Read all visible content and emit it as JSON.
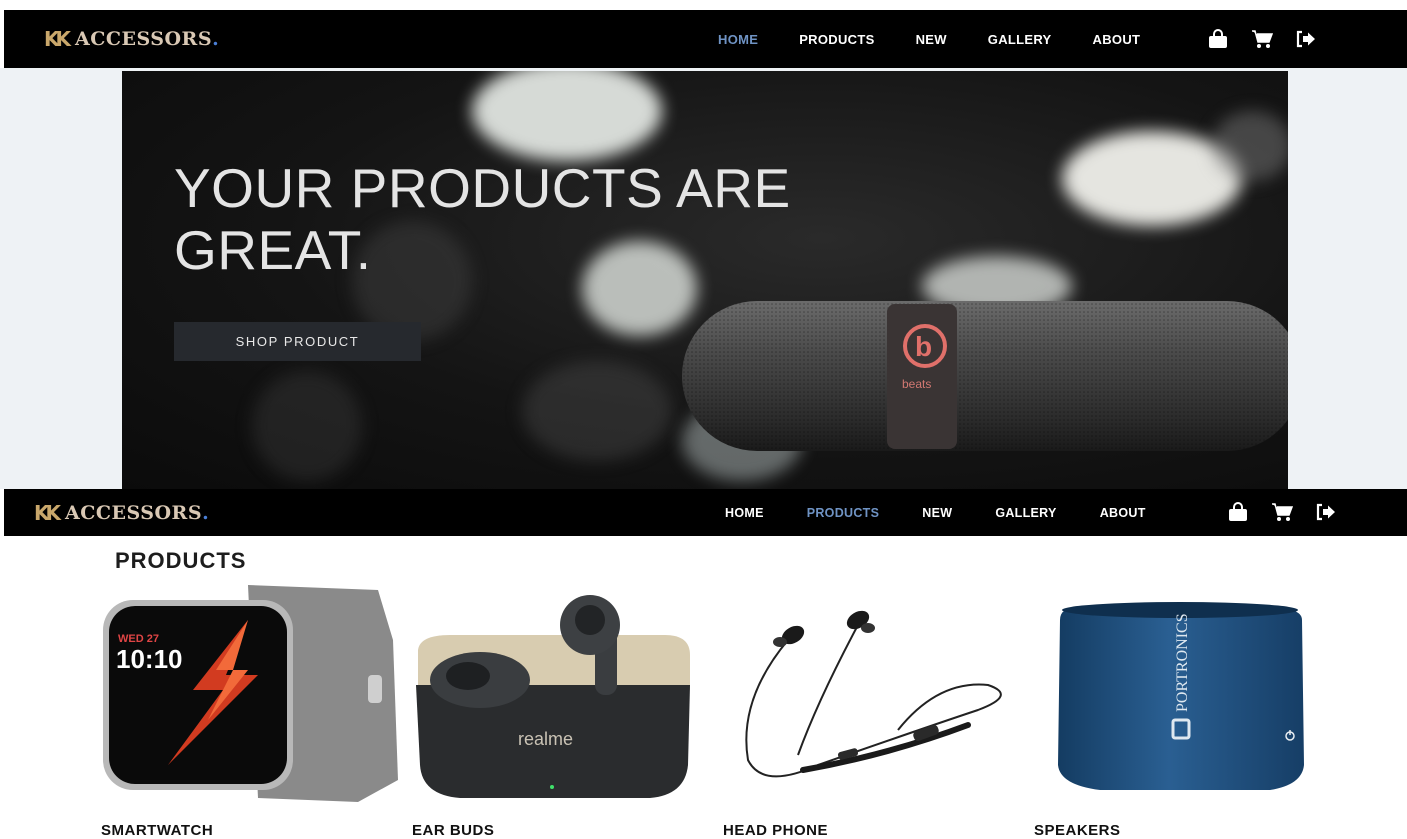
{
  "brand": {
    "name": "ACCESSORS",
    "dot": "."
  },
  "nav": {
    "items": [
      "HOME",
      "PRODUCTS",
      "NEW",
      "GALLERY",
      "ABOUT"
    ],
    "icons": [
      "shopping-bag-icon",
      "cart-icon",
      "logout-icon"
    ]
  },
  "nav_top": {
    "active": "HOME"
  },
  "nav_bottom": {
    "active": "PRODUCTS"
  },
  "hero": {
    "title_line1": "YOUR PRODUCTS ARE",
    "title_line2": "GREAT.",
    "button_label": "SHOP PRODUCT",
    "speaker_brand": "beats"
  },
  "products": {
    "title": "PRODUCTS",
    "items": [
      {
        "label": "SMARTWATCH",
        "screen_date": "WED 27",
        "screen_time": "10:10"
      },
      {
        "label": "EAR BUDS",
        "case_brand": "realme"
      },
      {
        "label": "HEAD PHONE"
      },
      {
        "label": "SPEAKERS",
        "speaker_brand": "PORTRONICS"
      }
    ]
  },
  "colors": {
    "active_link": "#6f93c4",
    "nav_bg": "#000000",
    "hero_bg": "#141414",
    "button_bg": "#26292e",
    "speaker_blue": "#1f4f7c"
  }
}
